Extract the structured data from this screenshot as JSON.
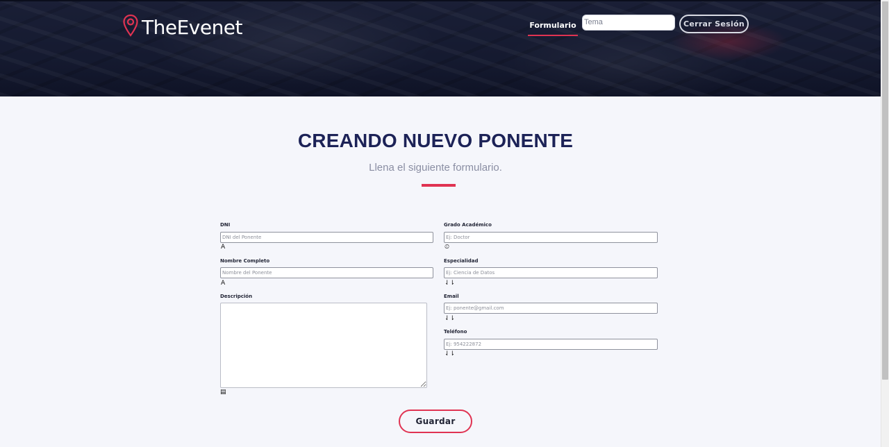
{
  "brand": {
    "name": "TheEvenet",
    "accent_color": "#e03352",
    "header_color": "#151a30"
  },
  "nav": {
    "formulario_label": "Formulario",
    "tema_placeholder": "Tema",
    "logout_label": "Cerrar Sesión"
  },
  "page": {
    "title": "CREANDO NUEVO PONENTE",
    "subtitle": "Llena el siguiente formulario."
  },
  "form": {
    "left": [
      {
        "label": "DNI",
        "placeholder": "DNI del Ponente",
        "icon": "text-icon",
        "icon_glyph": "A"
      },
      {
        "label": "Nombre Completo",
        "placeholder": "Nombre del Ponente",
        "icon": "text-icon",
        "icon_glyph": "A"
      },
      {
        "label": "Descripción",
        "icon": "keyboard-icon",
        "icon_glyph": "▤"
      }
    ],
    "right": [
      {
        "label": "Grado Académico",
        "placeholder": "Ej: Doctor",
        "icon": "clock-icon",
        "icon_glyph": "⏲"
      },
      {
        "label": "Especialidad",
        "placeholder": "Ej: Ciencia de Datos",
        "icon": "sort-icon",
        "icon_glyph": "⇃⇂"
      },
      {
        "label": "Email",
        "placeholder": "Ej: ponente@gmail.com",
        "icon": "sort-icon",
        "icon_glyph": "⇃⇂"
      },
      {
        "label": "Teléfono",
        "placeholder": "Ej: 954222872",
        "icon": "sort-icon",
        "icon_glyph": "⇃⇂"
      }
    ],
    "submit_label": "Guardar"
  }
}
